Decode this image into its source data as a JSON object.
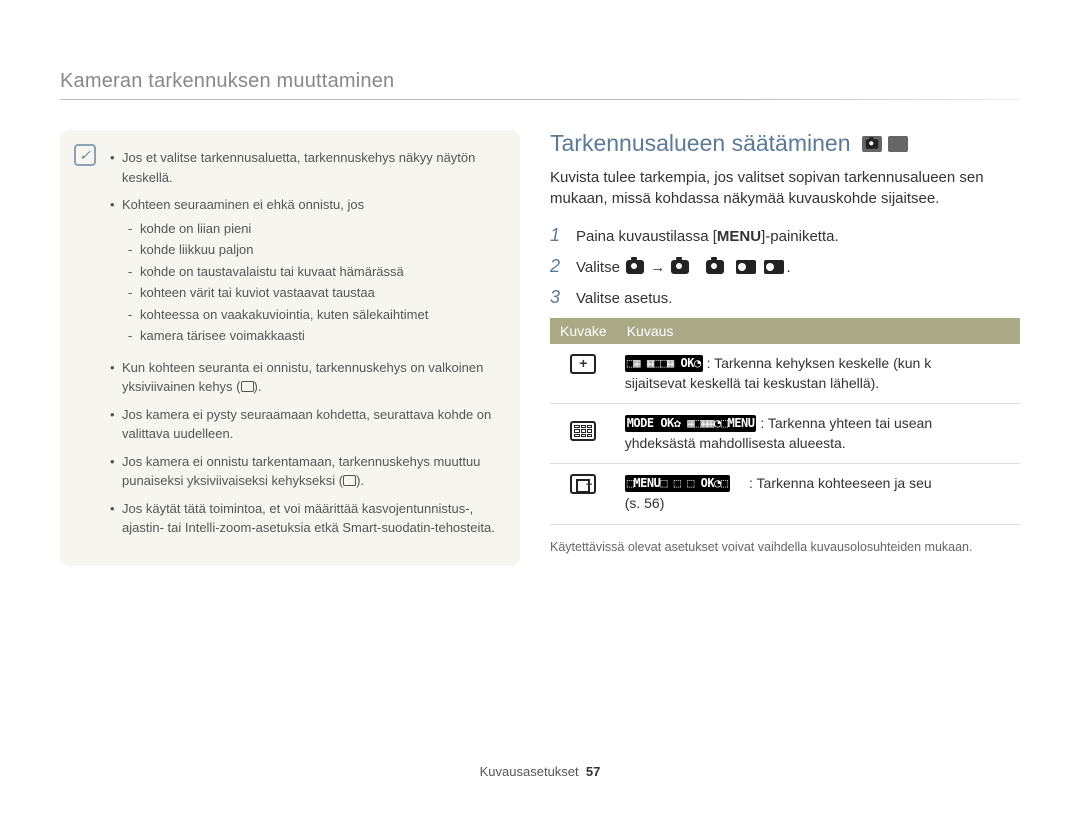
{
  "header": {
    "title": "Kameran tarkennuksen muuttaminen"
  },
  "note": {
    "icon_label": "✓",
    "bullets": {
      "b1": "Jos et valitse tarkennusaluetta, tarkennuskehys näkyy näytön keskellä.",
      "b2": "Kohteen seuraaminen ei ehkä onnistu, jos",
      "sub": {
        "s1": "kohde on liian pieni",
        "s2": "kohde liikkuu paljon",
        "s3": "kohde on taustavalaistu tai kuvaat hämärässä",
        "s4": "kohteen värit tai kuviot vastaavat taustaa",
        "s5": "kohteessa on vaakakuviointia, kuten sälekaihtimet",
        "s6": "kamera tärisee voimakkaasti"
      },
      "b3_a": "Kun kohteen seuranta ei onnistu, tarkennuskehys on valkoinen yksiviivainen kehys (",
      "b3_b": ").",
      "b4": "Jos kamera ei pysty seuraamaan kohdetta, seurattava kohde on valittava uudelleen.",
      "b5_a": "Jos kamera ei onnistu tarkentamaan, tarkennuskehys muuttuu punaiseksi yksiviivaiseksi kehykseksi (",
      "b5_b": ").",
      "b6": "Jos käytät tätä toimintoa, et voi määrittää kasvojentunnistus-, ajastin- tai Intelli-zoom-asetuksia etkä Smart-suodatin-tehosteita."
    }
  },
  "right": {
    "heading": "Tarkennusalueen säätäminen",
    "intro": "Kuvista tulee tarkempia, jos valitset sopivan tarkennusalueen sen mukaan, missä kohdassa näkymää kuvauskohde sijaitsee.",
    "steps": {
      "s1_a": "Paina kuvaustilassa [",
      "s1_menu": "MENU",
      "s1_b": "]-painiketta.",
      "s2_a": "Valitse ",
      "s2_arrow": "→",
      "s2_end": ".",
      "s3": "Valitse asetus."
    },
    "table": {
      "th1": "Kuvake",
      "th2": "Kuvaus",
      "r1": {
        "desc_a": ": Tarkenna kehyksen keskelle (kun k",
        "desc_b": "sijaitsevat keskellä tai keskustan lähellä)."
      },
      "r2": {
        "desc_a": ": Tarkenna yhteen tai usean",
        "desc_b": "yhdeksästä mahdollisesta alueesta."
      },
      "r3": {
        "desc_a": ": Tarkenna kohteeseen ja seu",
        "desc_b": "(s. 56)"
      }
    },
    "footnote": "Käytettävissä olevat asetukset voivat vaihdella kuvausolosuhteiden mukaan."
  },
  "footer": {
    "section": "Kuvausasetukset",
    "page": "57"
  }
}
